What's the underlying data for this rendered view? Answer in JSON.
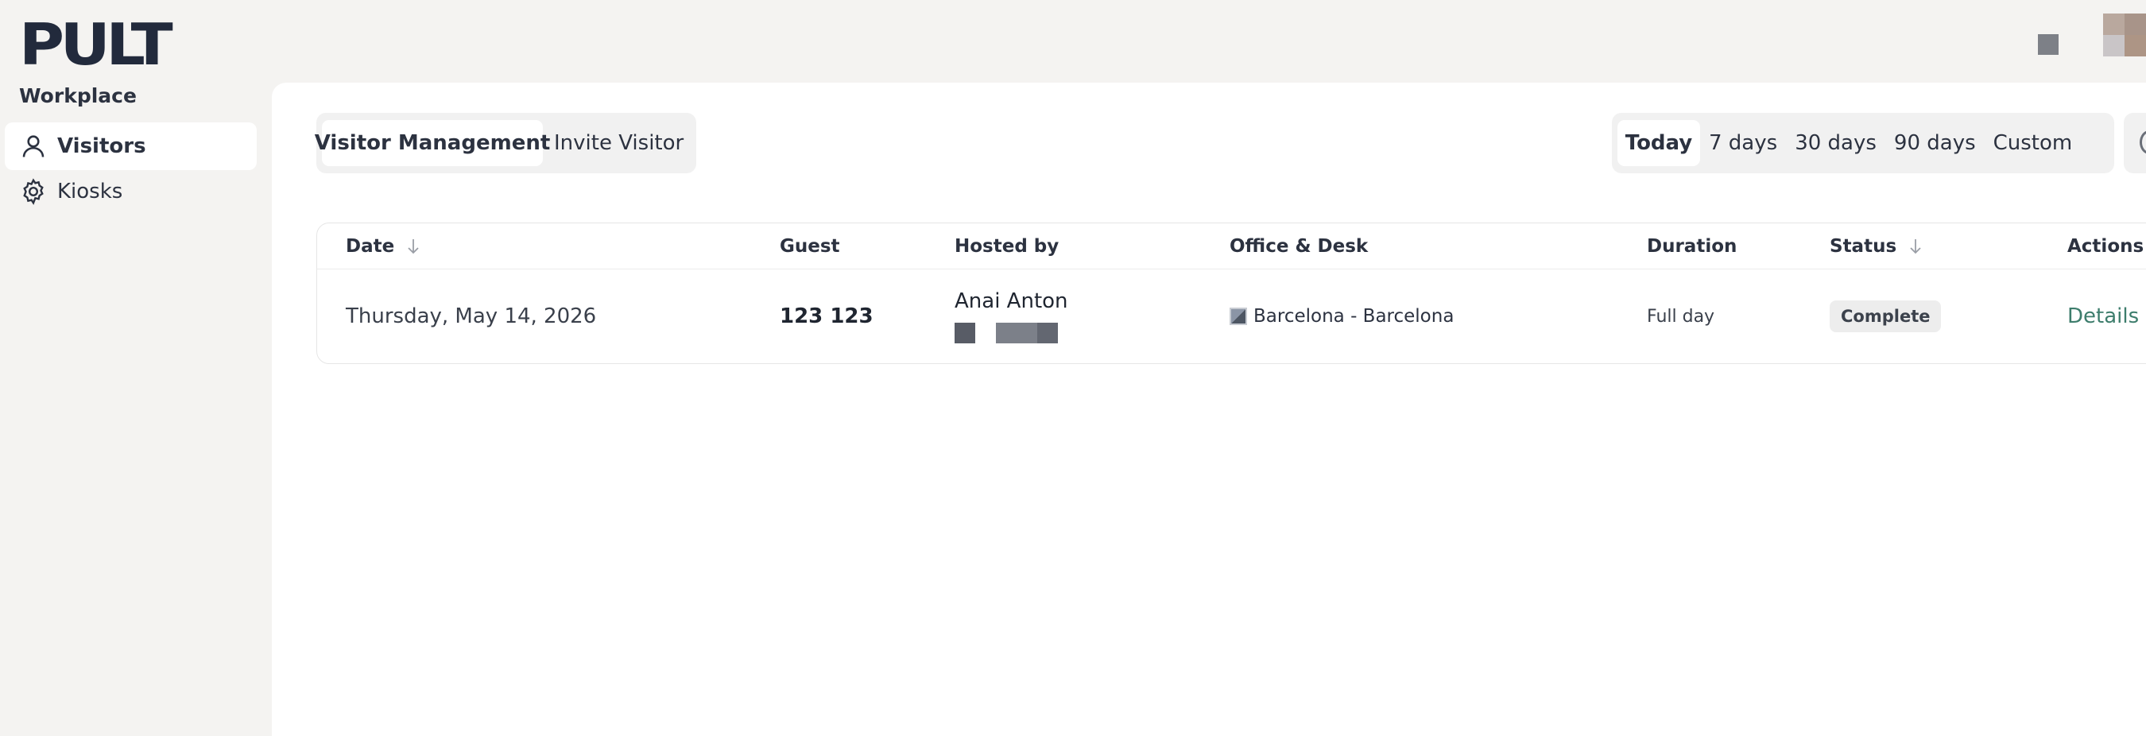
{
  "brand": {
    "logo_text": "PULT"
  },
  "header": {
    "notification_icon": "bell-icon",
    "avatar_icon": "user-avatar"
  },
  "sidebar": {
    "section_title": "Workplace",
    "items": [
      {
        "label": "Visitors",
        "icon": "person-icon",
        "active": true
      },
      {
        "label": "Kiosks",
        "icon": "gear-icon",
        "active": false
      }
    ]
  },
  "main": {
    "tabs": [
      {
        "label": "Visitor Management",
        "active": true
      },
      {
        "label": "Invite Visitor",
        "active": false
      }
    ],
    "date_filters": [
      {
        "label": "Today",
        "active": true
      },
      {
        "label": "7 days",
        "active": false
      },
      {
        "label": "30 days",
        "active": false
      },
      {
        "label": "90 days",
        "active": false
      },
      {
        "label": "Custom",
        "active": false
      }
    ],
    "table": {
      "columns": [
        "Date",
        "Guest",
        "Hosted by",
        "Office & Desk",
        "Duration",
        "Status",
        "Actions"
      ],
      "rows": [
        {
          "date": "Thursday, May 14, 2026",
          "guest": "123 123",
          "host_name": "Anai Anton",
          "office": "Barcelona - Barcelona",
          "duration": "Full day",
          "status": "Complete",
          "action": "Details"
        }
      ]
    }
  },
  "colors": {
    "page_bg": "#f4f3f1",
    "panel_bg": "#ffffff",
    "text": "#1f2530",
    "link_green": "#3d7d6c",
    "badge_bg": "#ededed"
  }
}
